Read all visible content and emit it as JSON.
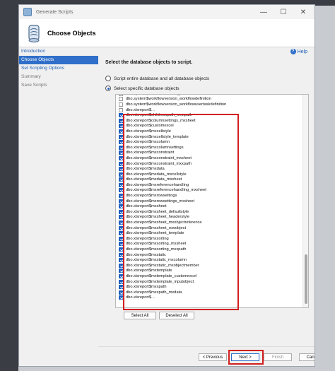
{
  "window": {
    "title": "Generate Scripts",
    "minimize": "—",
    "maximize": "☐",
    "close": "✕"
  },
  "header": {
    "title": "Choose Objects"
  },
  "nav": {
    "items": [
      {
        "label": "Introduction",
        "state": "link"
      },
      {
        "label": "Choose Objects",
        "state": "active"
      },
      {
        "label": "Set Scripting Options",
        "state": "link"
      },
      {
        "label": "Summary",
        "state": "disabled"
      },
      {
        "label": "Save Scripts",
        "state": "disabled"
      }
    ]
  },
  "help": {
    "label": "Help",
    "icon": "?"
  },
  "instruction": "Select the database objects to script.",
  "options": {
    "entire_db": "Script entire database and all database objects",
    "specific": "Select specific database objects",
    "selected": "specific"
  },
  "objects": [
    {
      "name": "dbo.system$workflowversion_previousversion",
      "checked": false
    },
    {
      "name": "dbo.system$workflowversion_workflowdefinition",
      "checked": false
    },
    {
      "name": "dbo.system$workflowversion_workflowusertaskdefinition",
      "checked": false
    },
    {
      "name": "dbo.xlsreport$...",
      "checked": false
    },
    {
      "name": "dbo.xlsreport$childmxxpath_mxxpath",
      "checked": true
    },
    {
      "name": "dbo.xlsreport$columnsettings_mxsheet",
      "checked": true
    },
    {
      "name": "dbo.xlsreport$customexcel",
      "checked": true
    },
    {
      "name": "dbo.xlsreport$mxcellstyle",
      "checked": true
    },
    {
      "name": "dbo.xlsreport$mxcellstyle_template",
      "checked": true
    },
    {
      "name": "dbo.xlsreport$mxcolumn",
      "checked": true
    },
    {
      "name": "dbo.xlsreport$mxcolumnsettings",
      "checked": true
    },
    {
      "name": "dbo.xlsreport$mxconstraint",
      "checked": true
    },
    {
      "name": "dbo.xlsreport$mxconstraint_mxsheet",
      "checked": true
    },
    {
      "name": "dbo.xlsreport$mxconstraint_mxxpath",
      "checked": true
    },
    {
      "name": "dbo.xlsreport$mxdata",
      "checked": true
    },
    {
      "name": "dbo.xlsreport$mxdata_mxcellstyle",
      "checked": true
    },
    {
      "name": "dbo.xlsreport$mxdata_mxsheet",
      "checked": true
    },
    {
      "name": "dbo.xlsreport$mxreferencehandling",
      "checked": true
    },
    {
      "name": "dbo.xlsreport$mxreferencehandling_mxsheet",
      "checked": true
    },
    {
      "name": "dbo.xlsreport$mxrowsettings",
      "checked": true
    },
    {
      "name": "dbo.xlsreport$mxrowsettings_mxsheet",
      "checked": true
    },
    {
      "name": "dbo.xlsreport$mxsheet",
      "checked": true
    },
    {
      "name": "dbo.xlsreport$mxsheet_defaultstyle",
      "checked": true
    },
    {
      "name": "dbo.xlsreport$mxsheet_headerstyle",
      "checked": true
    },
    {
      "name": "dbo.xlsreport$mxsheet_mxobjectreference",
      "checked": true
    },
    {
      "name": "dbo.xlsreport$mxsheet_rowobject",
      "checked": true
    },
    {
      "name": "dbo.xlsreport$mxsheet_template",
      "checked": true
    },
    {
      "name": "dbo.xlsreport$mxsorting",
      "checked": true
    },
    {
      "name": "dbo.xlsreport$mxsorting_mxsheet",
      "checked": true
    },
    {
      "name": "dbo.xlsreport$mxsorting_mxxpath",
      "checked": true
    },
    {
      "name": "dbo.xlsreport$mxstatic",
      "checked": true
    },
    {
      "name": "dbo.xlsreport$mxstatic_mxcolumn",
      "checked": true
    },
    {
      "name": "dbo.xlsreport$mxstatic_mxobjectmember",
      "checked": true
    },
    {
      "name": "dbo.xlsreport$mxtemplate",
      "checked": true
    },
    {
      "name": "dbo.xlsreport$mxtemplate_customexcel",
      "checked": true
    },
    {
      "name": "dbo.xlsreport$mxtemplate_inputobject",
      "checked": true
    },
    {
      "name": "dbo.xlsreport$mxxpath",
      "checked": true
    },
    {
      "name": "dbo.xlsreport$mxxpath_mxdata",
      "checked": true
    },
    {
      "name": "dbo.xlsreport$...",
      "checked": true
    }
  ],
  "list_buttons": {
    "select_all": "Select All",
    "deselect_all": "Deselect All"
  },
  "footer": {
    "previous": "< Previous",
    "next": "Next >",
    "finish": "Finish",
    "cancel": "Cancel"
  },
  "colors": {
    "accent": "#2f6fc9",
    "checkbox": "#1e5fbf",
    "highlight": "#d21f1f"
  }
}
